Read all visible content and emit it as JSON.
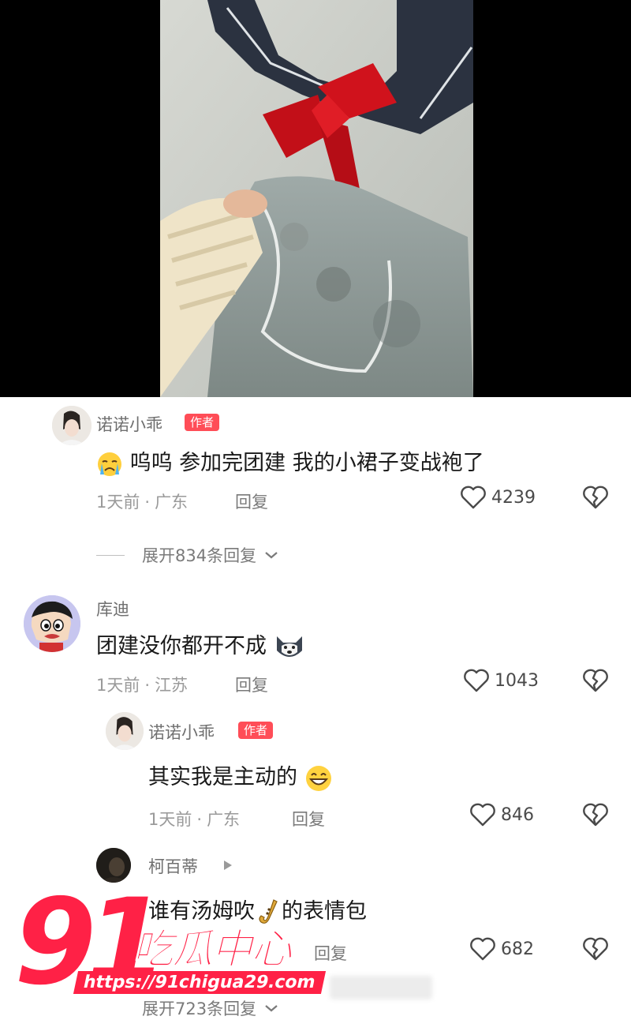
{
  "comments": [
    {
      "username": "诺诺小乖",
      "author_tag": "作者",
      "text": "呜呜 参加完团建 我的小裙子变战袍了",
      "emoji_prefix": "crying-face",
      "time": "1天前",
      "location": "广东",
      "reply_label": "回复",
      "likes": "4239",
      "expand_label": "展开834条回复"
    },
    {
      "username": "库迪",
      "text": "团建没你都开不成",
      "emoji_suffix": "husky-dog-face",
      "time": "1天前",
      "location": "江苏",
      "reply_label": "回复",
      "likes": "1043"
    },
    {
      "username": "诺诺小乖",
      "author_tag": "作者",
      "text": "其实我是主动的",
      "emoji_suffix": "grinning-face",
      "time": "1天前",
      "location": "广东",
      "reply_label": "回复",
      "likes": "846"
    },
    {
      "username": "柯百蒂",
      "text_before": "谁有汤姆吹",
      "text_after": "的表情包",
      "emoji_mid": "saxophone",
      "reply_label": "回复",
      "likes": "682",
      "expand_label": "展开723条回复"
    }
  ],
  "watermark": {
    "number": "91",
    "brand": "吃瓜中心",
    "url": "https://91chigua29.com"
  },
  "colors": {
    "author_tag_bg": "#ff4d57",
    "watermark_red": "#ff2146",
    "photo_background": "#000000"
  },
  "icons": {
    "like": "heart-outline-icon",
    "dislike": "broken-heart-icon",
    "expand": "chevron-down-icon",
    "reply_arrow": "play-triangle-icon"
  }
}
